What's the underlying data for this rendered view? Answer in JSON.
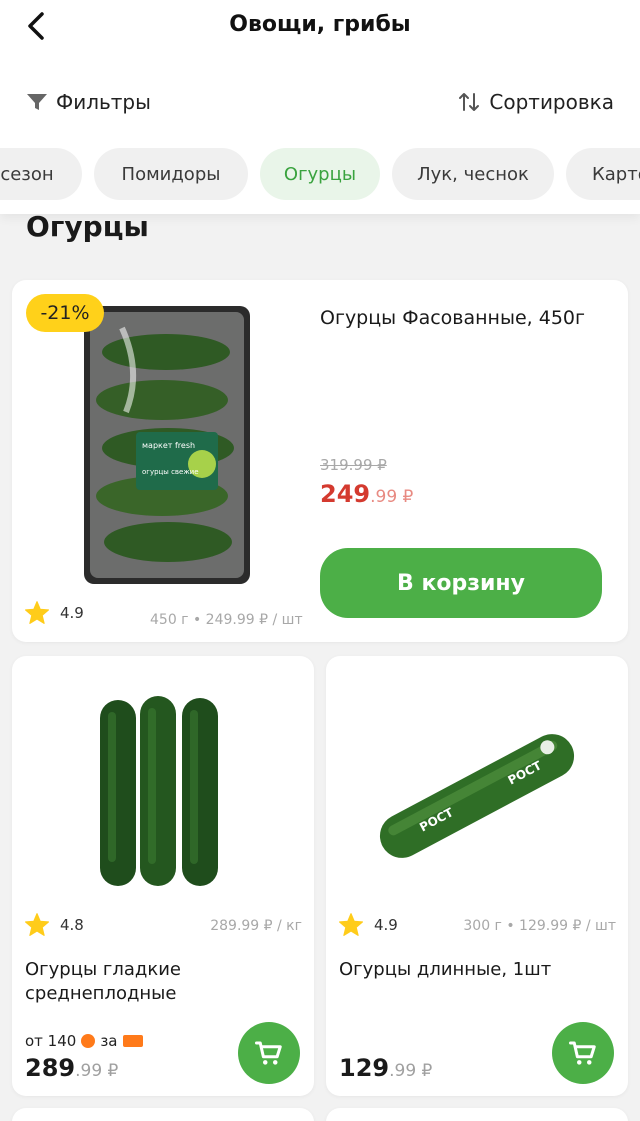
{
  "header": {
    "title": "Овощи, грибы",
    "filters_label": "Фильтры",
    "sort_label": "Сортировка"
  },
  "chips": [
    "сезон",
    "Помидоры",
    "Огурцы",
    "Лук, чеснок",
    "Карто"
  ],
  "section_title": "Огурцы",
  "products": [
    {
      "name": "Огурцы Фасованные, 450г",
      "discount": "-21%",
      "old_price": "319.99 ₽",
      "price_int": "249",
      "price_dec": ".99 ₽",
      "rating": "4.9",
      "unit": "450 г • 249.99 ₽ / шт",
      "cart_label": "В корзину",
      "brand": "маркет fresh",
      "pack_text": "огурцы свежие"
    },
    {
      "name": "Огурцы гладкие среднеплодные",
      "rating": "4.8",
      "unit": "289.99 ₽ / кг",
      "promo_from": "от 140",
      "promo_for": "за",
      "price_int": "289",
      "price_dec": ".99 ₽"
    },
    {
      "name": "Огурцы длинные, 1шт",
      "rating": "4.9",
      "unit": "300 г • 129.99 ₽ / шт",
      "price_int": "129",
      "price_dec": ".99 ₽",
      "wrap_text": "РОСТ"
    }
  ],
  "colors": {
    "accent_green": "#4caf47",
    "sale_red": "#d43a2f",
    "badge_yellow": "#ffd11a",
    "star": "#ffcc1a"
  }
}
